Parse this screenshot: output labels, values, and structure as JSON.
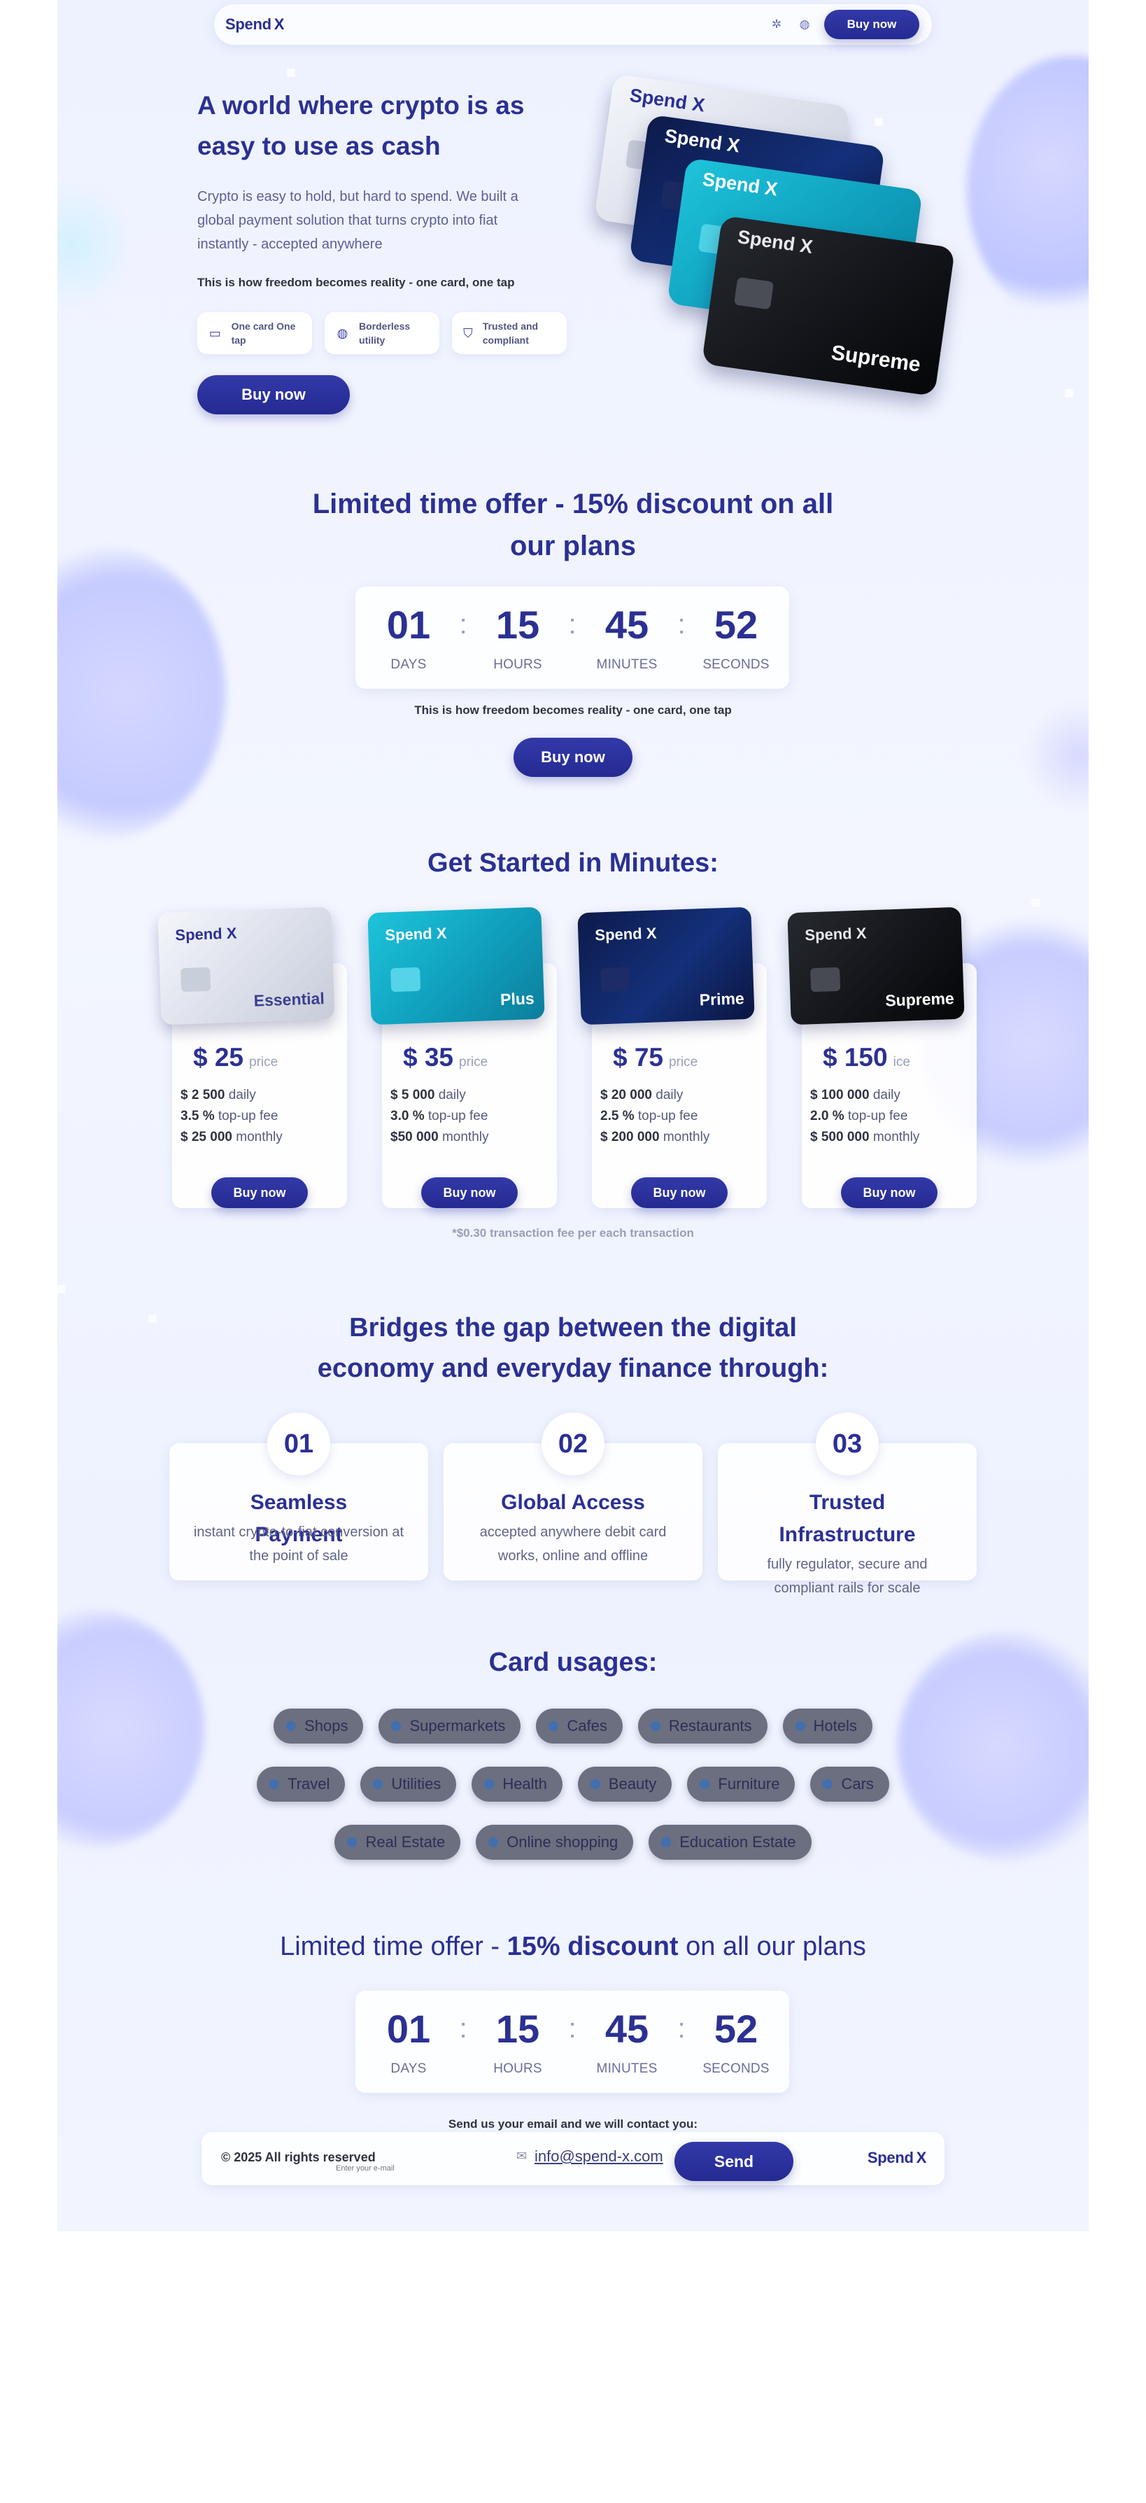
{
  "brand": {
    "name": "Spend",
    "mark": "X"
  },
  "header": {
    "buy_label": "Buy now",
    "icons": [
      "spark-icon",
      "globe-icon"
    ]
  },
  "hero": {
    "title": "A world where crypto is as easy to use as cash",
    "text": "Crypto is easy to hold, but hard to spend. We built a global payment solution that turns crypto into fiat instantly - accepted anywhere",
    "strong": "This is how freedom becomes reality - one card, one tap",
    "features": [
      {
        "icon": "card-icon",
        "label": "One card One tap"
      },
      {
        "icon": "globe-icon",
        "label": "Borderless utility"
      },
      {
        "icon": "shield-icon",
        "label": "Trusted and compliant"
      }
    ],
    "buy_label": "Buy now",
    "cards": [
      "Supreme"
    ]
  },
  "offer1": {
    "title": "Limited time offer - 15% discount on all our plans",
    "countdown": [
      {
        "value": "01",
        "label": "DAYS"
      },
      {
        "value": "15",
        "label": "HOURS"
      },
      {
        "value": "45",
        "label": "MINUTES"
      },
      {
        "value": "52",
        "label": "SECONDS"
      }
    ],
    "separator": ":",
    "strong": "This is how freedom becomes reality - one card, one tap",
    "buy_label": "Buy now"
  },
  "plans": {
    "title": "Get Started in Minutes:",
    "items": [
      {
        "tier": "Essential",
        "price": "$ 25",
        "price_label": "price",
        "daily": "$ 2 500",
        "fee": "3.5 %",
        "monthly": "$ 25 000",
        "buy_label": "Buy now"
      },
      {
        "tier": "Plus",
        "price": "$ 35",
        "price_label": "price",
        "daily": "$ 5 000",
        "fee": "3.0 %",
        "monthly": "$50 000",
        "buy_label": "Buy now"
      },
      {
        "tier": "Prime",
        "price": "$ 75",
        "price_label": "price",
        "daily": "$ 20 000",
        "fee": "2.5 %",
        "monthly": "$ 200 000",
        "buy_label": "Buy now"
      },
      {
        "tier": "Supreme",
        "price": "$ 150",
        "price_label": "ice",
        "daily": "$ 100 000",
        "fee": "2.0 %",
        "monthly": "$ 500 000",
        "buy_label": "Buy now"
      }
    ],
    "daily_label": "daily",
    "fee_label": "top-up fee",
    "monthly_label": "monthly",
    "note": "*$0.30 transaction fee per each transaction"
  },
  "bridge": {
    "title": "Bridges the gap between the digital economy and everyday finance through:",
    "items": [
      {
        "num": "01",
        "title": "Seamless Payment",
        "desc": "instant crypto-to-fiat conversion at the point of sale"
      },
      {
        "num": "02",
        "title": "Global Access",
        "desc": "accepted anywhere debit card works, online and offline"
      },
      {
        "num": "03",
        "title": "Trusted Infrastructure",
        "desc": "fully regulator, secure and compliant rails for scale"
      }
    ]
  },
  "usages": {
    "title": "Card usages:",
    "row1": [
      "Shops",
      "Supermarkets",
      "Cafes",
      "Restaurants",
      "Hotels"
    ],
    "row2": [
      "Travel",
      "Utilities",
      "Health",
      "Beauty",
      "Furniture",
      "Cars"
    ],
    "row3": [
      "Real Estate",
      "Online shopping",
      "Education Estate"
    ]
  },
  "offer2": {
    "title_pre": "Limited time offer - ",
    "title_bold": "15% discount",
    "title_post": " on all our plans",
    "countdown": [
      {
        "value": "01",
        "label": "DAYS"
      },
      {
        "value": "15",
        "label": "HOURS"
      },
      {
        "value": "45",
        "label": "MINUTES"
      },
      {
        "value": "52",
        "label": "SECONDS"
      }
    ],
    "separator": ":",
    "contact": "Send us your email and we will contact you:"
  },
  "footer": {
    "copyright": "© 2025 All rights reserved",
    "email_placeholder": "Enter your e-mail",
    "email": "info@spend-x.com",
    "send_label": "Send"
  },
  "colors": {
    "primary": "#2b3093",
    "button": "#262b8f",
    "chip": "#6b6f80",
    "background": "#eef2ff"
  }
}
